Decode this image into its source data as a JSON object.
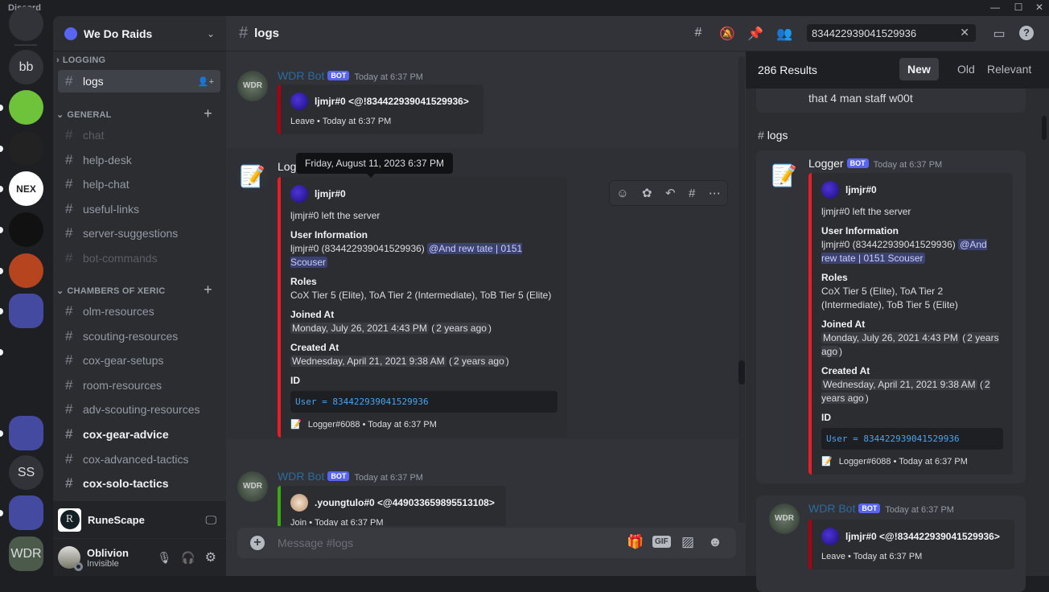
{
  "window": {
    "app_name": "Discord",
    "min": "—",
    "max": "☐",
    "close": "✕"
  },
  "servers": [
    {
      "name": "home",
      "label": "",
      "color": "#313338"
    },
    {
      "name": "bb",
      "label": "bb",
      "color": "#313338"
    },
    {
      "name": "green-frog",
      "label": "",
      "color": "#6fc33b"
    },
    {
      "name": "grey-logo",
      "label": "",
      "color": "#222"
    },
    {
      "name": "nex",
      "label": "NEX",
      "color": "#ffffff"
    },
    {
      "name": "dragon",
      "label": "",
      "color": "#111"
    },
    {
      "name": "orange-dragon",
      "label": "",
      "color": "#b5441f"
    },
    {
      "name": "folder-1",
      "label": "",
      "color": "#434a9f"
    },
    {
      "name": "helmet",
      "label": "",
      "color": "#1e1f22"
    },
    {
      "name": "bunny",
      "label": "",
      "color": "#1e1f22"
    },
    {
      "name": "folder-2",
      "label": "",
      "color": "#434a9f"
    },
    {
      "name": "ss",
      "label": "SS",
      "color": "#313338"
    },
    {
      "name": "folder-3",
      "label": "",
      "color": "#434a9f"
    },
    {
      "name": "wdr",
      "label": "WDR",
      "color": "#4b5a4a"
    }
  ],
  "sidebar": {
    "server_name": "We Do Raids",
    "categories": [
      {
        "label": "LOGGING"
      },
      {
        "label": "GENERAL"
      },
      {
        "label": "CHAMBERS OF XERIC"
      }
    ],
    "channels": {
      "logging": [
        {
          "name": "logs",
          "state": "active"
        }
      ],
      "general": [
        {
          "name": "chat",
          "state": "muted"
        },
        {
          "name": "help-desk",
          "state": "normal"
        },
        {
          "name": "help-chat",
          "state": "normal"
        },
        {
          "name": "useful-links",
          "state": "normal"
        },
        {
          "name": "server-suggestions",
          "state": "normal"
        },
        {
          "name": "bot-commands",
          "state": "muted"
        }
      ],
      "cox": [
        {
          "name": "olm-resources",
          "state": "normal"
        },
        {
          "name": "scouting-resources",
          "state": "normal"
        },
        {
          "name": "cox-gear-setups",
          "state": "normal"
        },
        {
          "name": "room-resources",
          "state": "normal"
        },
        {
          "name": "adv-scouting-resources",
          "state": "normal"
        },
        {
          "name": "cox-gear-advice",
          "state": "unread"
        },
        {
          "name": "cox-advanced-tactics",
          "state": "normal"
        },
        {
          "name": "cox-solo-tactics",
          "state": "unread"
        }
      ]
    },
    "activity": {
      "game": "RuneScape"
    },
    "user": {
      "name": "Oblivion",
      "status": "Invisible"
    }
  },
  "channel": {
    "name": "logs",
    "search_value": "834422939041529936",
    "composer_placeholder": "Message #logs"
  },
  "messages": [
    {
      "author": "WDR Bot",
      "author_color": "#2c6ba0",
      "bot": "BOT",
      "time": "Today at 6:37 PM",
      "embed": {
        "color": "#b00010",
        "author": "ljmjr#0  <@!834422939041529936>",
        "footer": "Leave • Today at 6:37 PM"
      }
    },
    {
      "author": "Logger",
      "author_color": "#f2f3f5",
      "bot": "BOT",
      "time": "Today at 6:37 PM",
      "tooltip": "Friday, August 11, 2023 6:37 PM",
      "embed": {
        "color": "#ed1c24",
        "author": "ljmjr#0",
        "description": "ljmjr#0 left the server",
        "fields": {
          "user_info_label": "User Information",
          "user_info_value": "ljmjr#0 (834422939041529936)",
          "user_info_mention": "@And rew tate | 0151 Scouser",
          "roles_label": "Roles",
          "roles_value": "CoX Tier 5 (Elite), ToA Tier 2 (Intermediate), ToB Tier 5 (Elite)",
          "joined_label": "Joined At",
          "joined_value": "Monday, July 26, 2021 4:43 PM",
          "joined_rel": "2 years ago",
          "created_label": "Created At",
          "created_value": "Wednesday, April 21, 2021 9:38 AM",
          "created_rel": "2 years ago",
          "id_label": "ID",
          "id_code": "User = 834422939041529936"
        },
        "footer": "Logger#6088 • Today at 6:37 PM"
      }
    },
    {
      "author": "WDR Bot",
      "author_color": "#2c6ba0",
      "bot": "BOT",
      "time": "Today at 6:37 PM",
      "embed": {
        "color": "#3ba816",
        "author": ".youngtulo#0  <@449033659895513108>",
        "footer": "Join • Today at 6:37 PM"
      }
    }
  ],
  "results": {
    "count": "286 Results",
    "sort": [
      "New",
      "Old",
      "Relevant"
    ],
    "sort_active": "New",
    "prev_snippet": "that 4 man staff w00t",
    "channel_label": "logs"
  }
}
